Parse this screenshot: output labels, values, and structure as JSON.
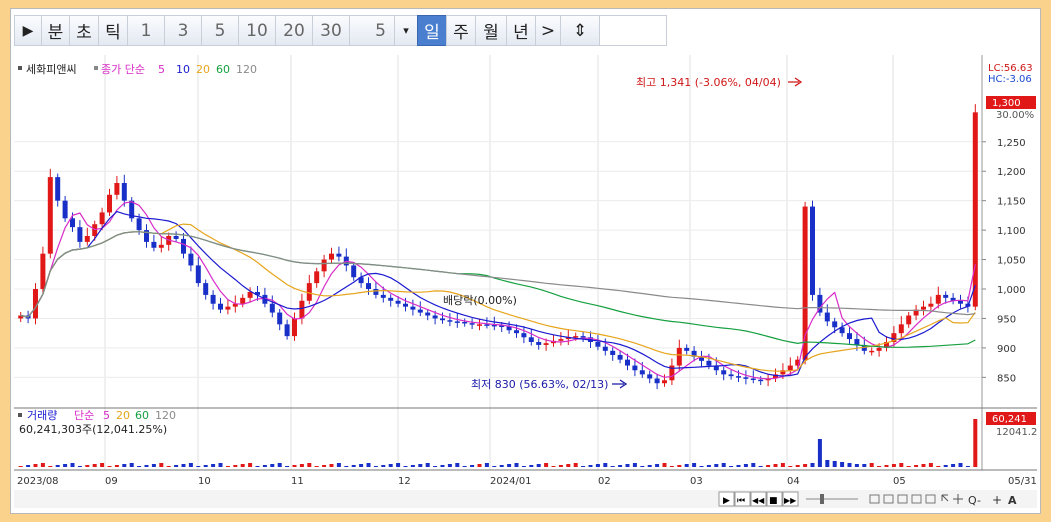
{
  "toolbar": {
    "play_icon": "▶",
    "period_tabs": [
      "분",
      "초",
      "틱"
    ],
    "intervals": [
      "1",
      "3",
      "5",
      "10",
      "20",
      "30"
    ],
    "custom_interval": "5",
    "dropdown_icon": "▾",
    "period_tabs2": [
      "일",
      "주",
      "월",
      "년"
    ],
    "active_period": "일",
    "next_icon": ">",
    "compress_icon": "⇕"
  },
  "price_panel": {
    "legend_name": "세화피앤씨",
    "legend_ma": "종가 단순",
    "ma_periods": [
      "5",
      "10",
      "20",
      "60",
      "120"
    ],
    "ma_colors": [
      "#d82cc8",
      "#1a1ad0",
      "#e6a51c",
      "#16a040",
      "#8a8a8a"
    ],
    "lc_label": "LC:56.63",
    "hc_label": "HC:-3.06",
    "current_price_badge": "1,300",
    "current_pct": "30.00%",
    "high_annotation": "최고 1,341 (-3.06%, 04/04)",
    "low_annotation": "최저 830 (56.63%, 02/13)",
    "dividend_label": "배당락(0.00%)",
    "y_ticks": [
      "1,250",
      "1,200",
      "1,150",
      "1,100",
      "1,050",
      "1,000",
      "950",
      "900",
      "850"
    ]
  },
  "volume_panel": {
    "legend_name": "거래량",
    "legend_ma": "단순",
    "ma_periods": [
      "5",
      "20",
      "60",
      "120"
    ],
    "value_line": "60,241,303주(12,041.25%)",
    "badge": "60,241",
    "sub_label": "12041.2"
  },
  "x_axis": {
    "labels": [
      "2023/08",
      "09",
      "10",
      "11",
      "12",
      "2024/01",
      "02",
      "03",
      "04",
      "05",
      "05/31"
    ]
  },
  "scroll": {
    "buttons": [
      "◀",
      "▶",
      "⏮",
      "◀◀",
      "■",
      "▶▶"
    ],
    "zoom_out": "Q-",
    "zoom_in": "+",
    "font_label": "A"
  },
  "colors": {
    "up": "#e01818",
    "down": "#1830c8",
    "accent": "#4a7fd0"
  },
  "chart_data": {
    "type": "candlestick",
    "y_range": [
      820,
      1360
    ],
    "closes": [
      955,
      950,
      1000,
      1060,
      1190,
      1150,
      1120,
      1105,
      1080,
      1090,
      1110,
      1130,
      1160,
      1180,
      1150,
      1120,
      1100,
      1080,
      1070,
      1075,
      1090,
      1085,
      1060,
      1040,
      1010,
      990,
      975,
      965,
      970,
      975,
      985,
      995,
      990,
      975,
      960,
      940,
      920,
      950,
      980,
      1010,
      1030,
      1050,
      1060,
      1055,
      1040,
      1020,
      1010,
      1000,
      990,
      985,
      980,
      975,
      970,
      965,
      960,
      955,
      950,
      947,
      945,
      944,
      942,
      940,
      940,
      939,
      938,
      937,
      930,
      925,
      918,
      910,
      905,
      908,
      912,
      915,
      918,
      920,
      918,
      910,
      902,
      895,
      888,
      880,
      870,
      862,
      855,
      848,
      840,
      845,
      870,
      900,
      895,
      885,
      878,
      870,
      862,
      855,
      852,
      850,
      848,
      846,
      845,
      848,
      855,
      862,
      870,
      880,
      1140,
      990,
      960,
      945,
      935,
      925,
      915,
      905,
      895,
      895,
      900,
      910,
      925,
      940,
      955,
      965,
      970,
      975,
      990,
      985,
      980,
      975,
      970,
      1300
    ]
  }
}
